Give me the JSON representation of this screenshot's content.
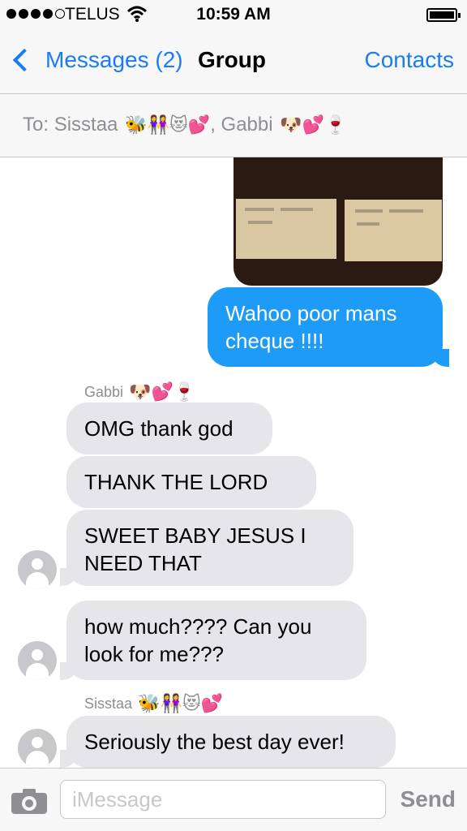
{
  "status": {
    "carrier": "TELUS",
    "time": "10:59 AM",
    "signal_bars": 4,
    "signal_max": 5,
    "battery_level": 1.0
  },
  "nav": {
    "back_label": "Messages (2)",
    "title": "Group",
    "contacts_label": "Contacts"
  },
  "to": {
    "prefix": "To:",
    "recipients": [
      {
        "name": "Sisstaa",
        "emoji": "🐝👭😻💕",
        "separator": ","
      },
      {
        "name": "Gabbi",
        "emoji": "🐶💕🍷",
        "separator": ""
      }
    ]
  },
  "messages": [
    {
      "type": "sent",
      "text_lines": [
        "Wahoo poor mans",
        "cheque !!!!"
      ]
    },
    {
      "type": "sender",
      "name": "Gabbi",
      "emoji": "🐶💕🍷"
    },
    {
      "type": "received",
      "text_lines": [
        "OMG thank god"
      ]
    },
    {
      "type": "received",
      "text_lines": [
        "THANK THE LORD"
      ]
    },
    {
      "type": "received",
      "text_lines": [
        "SWEET BABY JESUS I",
        "NEED THAT"
      ],
      "avatar": true
    },
    {
      "type": "received",
      "text_lines": [
        "how much???? Can you",
        "look for me???"
      ],
      "avatar": true
    },
    {
      "type": "sender",
      "name": "Sisstaa",
      "emoji": "🐝👭😻💕"
    },
    {
      "type": "received",
      "text_lines": [
        "Seriously the best day ever!"
      ],
      "avatar": true
    }
  ],
  "input": {
    "placeholder": "iMessage",
    "value": "",
    "send_label": "Send"
  },
  "colors": {
    "accent": "#1a7cf5",
    "sent_bubble": "#1d9bf6",
    "received_bubble": "#e5e5ea",
    "bar_background": "#f7f7f8"
  },
  "icons": {
    "back": "chevron-left-icon",
    "camera": "camera-icon",
    "avatar": "person-silhouette-icon",
    "wifi": "wifi-icon",
    "battery": "battery-icon"
  }
}
